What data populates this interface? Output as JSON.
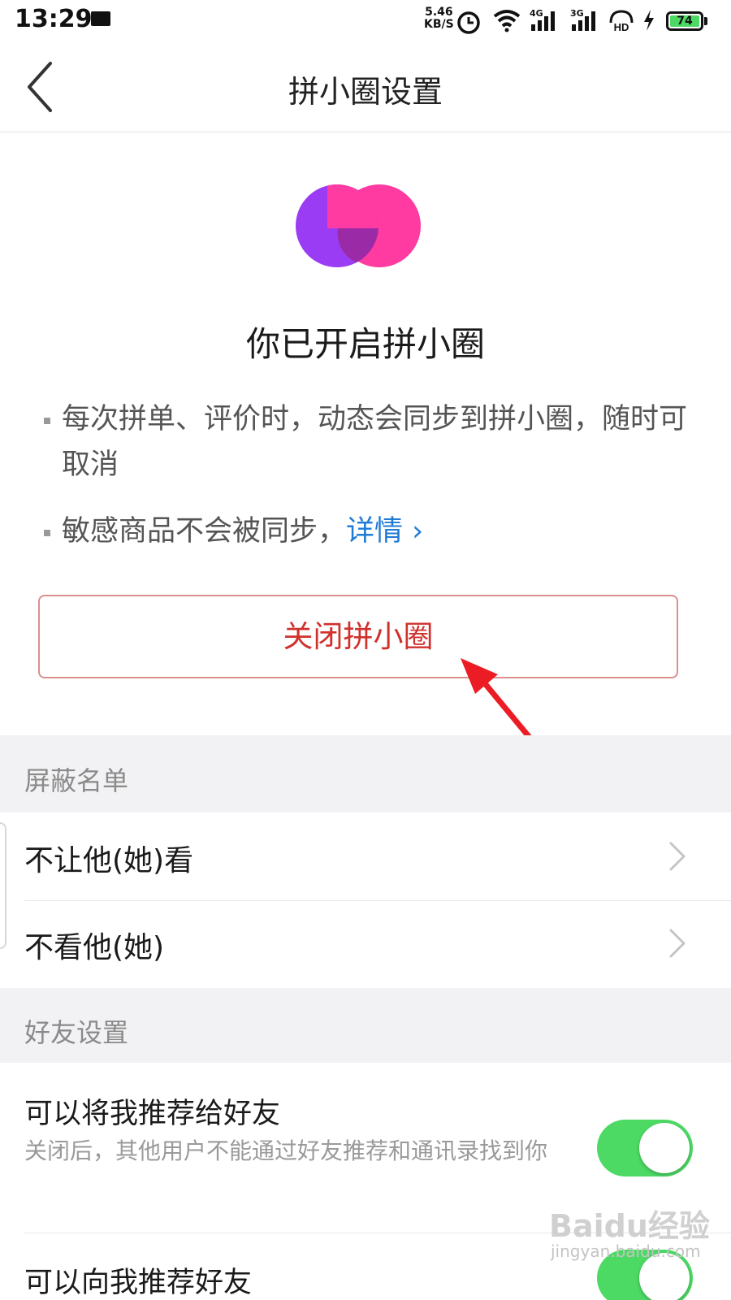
{
  "status_bar": {
    "time": "13:29",
    "speed_value": "5.46",
    "speed_unit": "KB/S",
    "signal1": "4G",
    "signal2": "3G",
    "hd": "HD",
    "battery": "74"
  },
  "nav": {
    "title": "拼小圈设置"
  },
  "main": {
    "headline": "你已开启拼小圈",
    "bullet1": "每次拼单、评价时，动态会同步到拼小圈，随时可取消",
    "bullet2": "敏感商品不会被同步，",
    "bullet2_link": "详情 ›",
    "close_button": "关闭拼小圈"
  },
  "blocklist": {
    "header": "屏蔽名单",
    "items": [
      {
        "label": "不让他(她)看"
      },
      {
        "label": "不看他(她)"
      }
    ]
  },
  "friends": {
    "header": "好友设置",
    "items": [
      {
        "title": "可以将我推荐给好友",
        "desc": "关闭后，其他用户不能通过好友推荐和通讯录找到你",
        "enabled": true
      },
      {
        "title": "可以向我推荐好友",
        "enabled": true
      }
    ]
  },
  "watermark": {
    "main": "Baidu经验",
    "sub": "jingyan.baidu.com"
  },
  "colors": {
    "accent_red": "#d0312d",
    "link_blue": "#1f7bd6",
    "toggle_green": "#4cd964",
    "logo_purple": "#9b3cf5",
    "logo_pink": "#ff3aa0"
  }
}
